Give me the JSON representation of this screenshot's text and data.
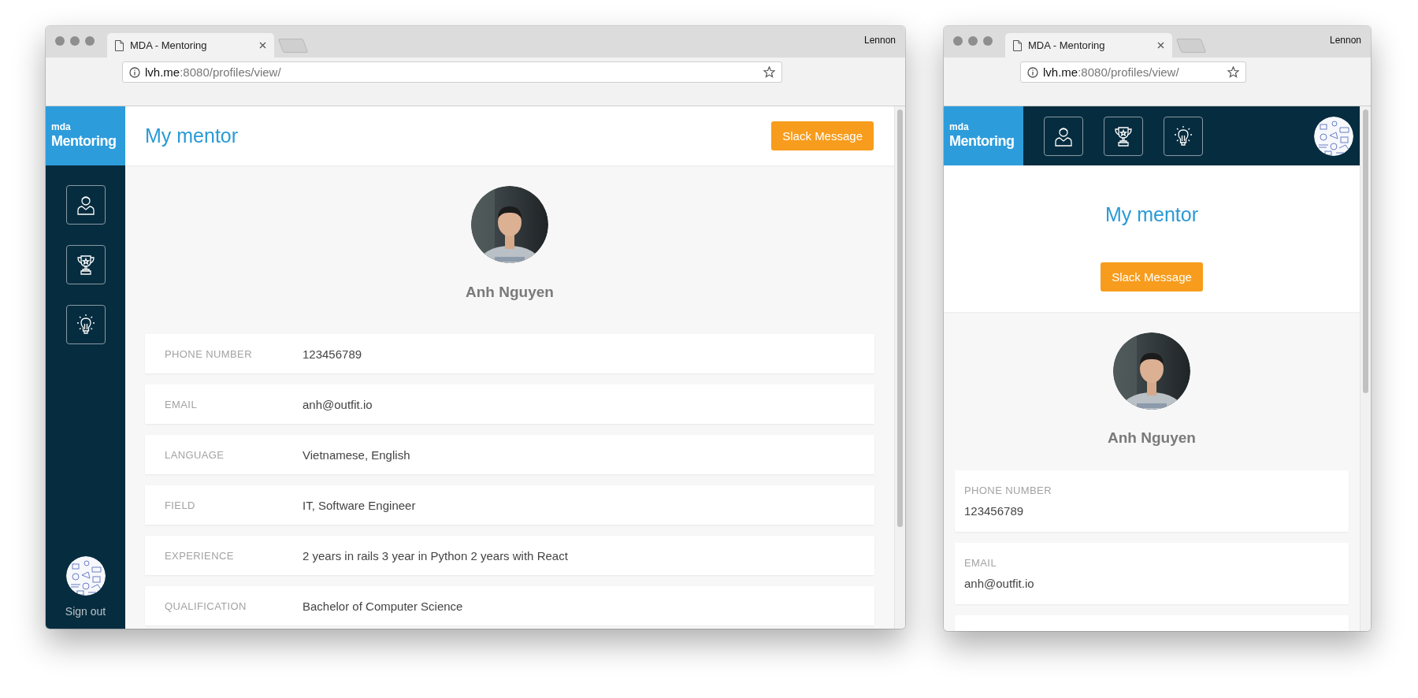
{
  "windows": [
    {
      "kind": "sidebar",
      "tab": {
        "title": "MDA - Mentoring"
      },
      "user": "Lennon",
      "address": {
        "host": "lvh.me",
        "path": ":8080/profiles/view/"
      },
      "logo": {
        "small": "mda",
        "large": "Mentoring"
      },
      "nav": [
        {
          "kind": "person"
        },
        {
          "kind": "trophy"
        },
        {
          "kind": "bulb"
        }
      ],
      "sign_out": "Sign out",
      "title": "My mentor",
      "action": "Slack Message",
      "name": "Anh Nguyen",
      "fields": [
        {
          "label": "PHONE NUMBER",
          "value": "123456789"
        },
        {
          "label": "EMAIL",
          "value": "anh@outfit.io"
        },
        {
          "label": "LANGUAGE",
          "value": "Vietnamese, English"
        },
        {
          "label": "FIELD",
          "value": "IT, Software Engineer"
        },
        {
          "label": "EXPERIENCE",
          "value": "2 years in rails 3 year in Python 2 years with React"
        },
        {
          "label": "QUALIFICATION",
          "value": "Bachelor of Computer Science"
        }
      ]
    },
    {
      "kind": "topbar",
      "tab": {
        "title": "MDA - Mentoring"
      },
      "user": "Lennon",
      "address": {
        "host": "lvh.me",
        "path": ":8080/profiles/view/"
      },
      "logo": {
        "small": "mda",
        "large": "Mentoring"
      },
      "nav": [
        {
          "kind": "person"
        },
        {
          "kind": "trophy"
        },
        {
          "kind": "bulb"
        }
      ],
      "title": "My mentor",
      "action": "Slack Message",
      "name": "Anh Nguyen",
      "fields": [
        {
          "label": "PHONE NUMBER",
          "value": "123456789"
        },
        {
          "label": "EMAIL",
          "value": "anh@outfit.io"
        }
      ]
    }
  ]
}
